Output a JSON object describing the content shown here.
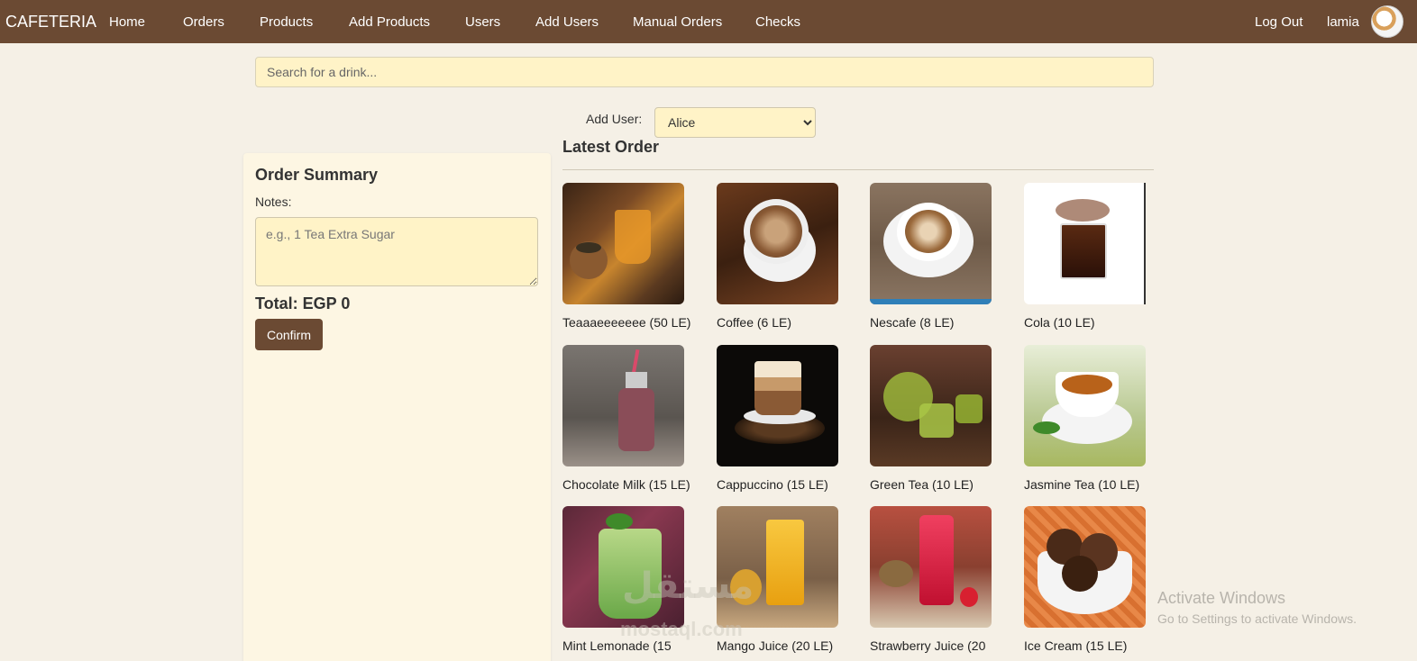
{
  "navbar": {
    "brand": "CAFETERIA",
    "links": [
      "Home",
      "Orders",
      "Products",
      "Add Products",
      "Users",
      "Add Users",
      "Manual Orders",
      "Checks"
    ],
    "logout": "Log Out",
    "username": "lamia"
  },
  "search": {
    "placeholder": "Search for a drink..."
  },
  "add_user": {
    "label": "Add User:",
    "selected": "Alice"
  },
  "latest_order": {
    "title": "Latest Order"
  },
  "summary": {
    "title": "Order Summary",
    "notes_label": "Notes:",
    "notes_placeholder": "e.g., 1 Tea Extra Sugar",
    "total": "Total: EGP 0",
    "confirm": "Confirm"
  },
  "products": [
    {
      "label": "Teaaaeeeeeee (50 LE)"
    },
    {
      "label": "Coffee (6 LE)"
    },
    {
      "label": "Nescafe (8 LE)"
    },
    {
      "label": "Cola (10 LE)"
    },
    {
      "label": "Chocolate Milk (15 LE)"
    },
    {
      "label": "Cappuccino (15 LE)"
    },
    {
      "label": "Green Tea (10 LE)"
    },
    {
      "label": "Jasmine Tea (10 LE)"
    },
    {
      "label": "Mint Lemonade (15"
    },
    {
      "label": "Mango Juice (20 LE)"
    },
    {
      "label": "Strawberry Juice (20"
    },
    {
      "label": "Ice Cream (15 LE)"
    }
  ],
  "watermark": {
    "activate_title": "Activate Windows",
    "activate_sub": "Go to Settings to activate Windows.",
    "site_ar": "مستقل",
    "site": "mostaql.com"
  }
}
